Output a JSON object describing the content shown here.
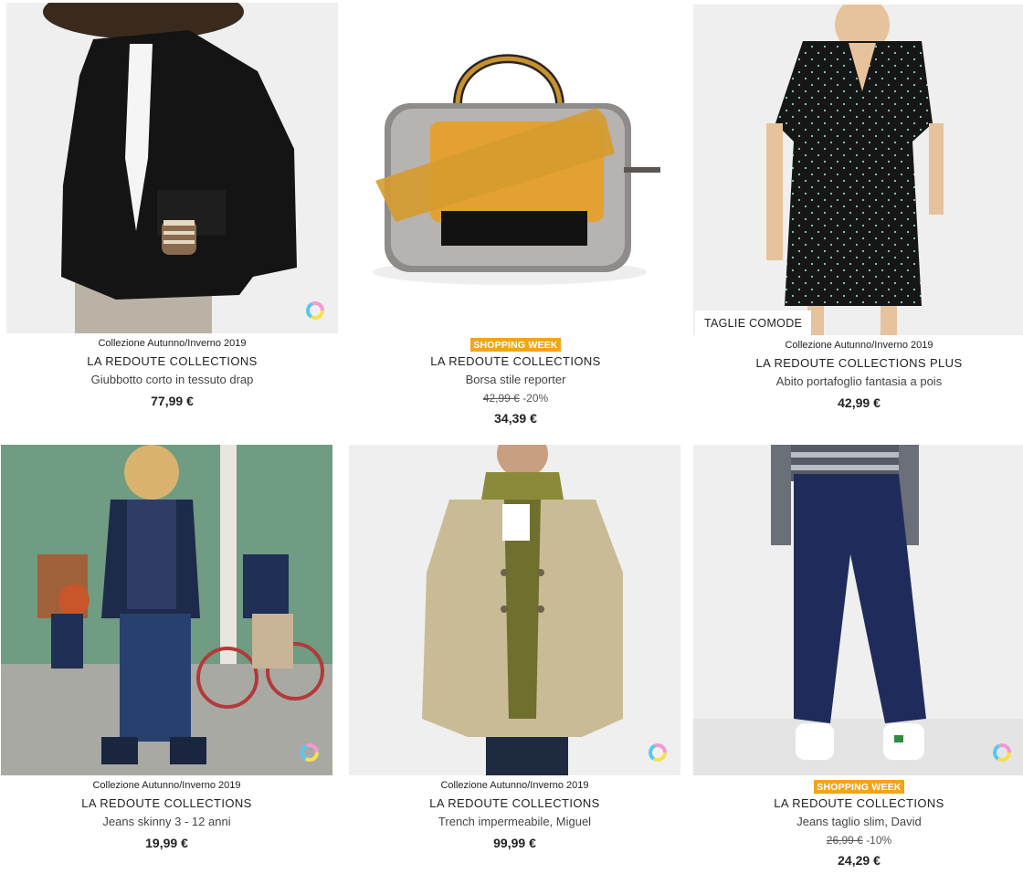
{
  "products": [
    {
      "collection": "Collezione Autunno/Inverno 2019",
      "brand": "LA REDOUTE COLLECTIONS",
      "title": "Giubbotto corto in tessuto drap",
      "price": "77,99 €",
      "image_icon": "black-jacket-photo",
      "swatch_icon": "color-swatch-icon"
    },
    {
      "badge": "SHOPPING WEEK",
      "brand": "LA REDOUTE COLLECTIONS",
      "title": "Borsa stile reporter",
      "old_price": "42,99 €",
      "discount": "-20%",
      "price": "34,39 €",
      "image_icon": "reporter-bag-photo"
    },
    {
      "collection": "Collezione Autunno/Inverno 2019",
      "brand": "LA REDOUTE COLLECTIONS PLUS",
      "title": "Abito portafoglio fantasia a pois",
      "price": "42,99 €",
      "size_tag": "TAGLIE COMODE",
      "image_icon": "polka-dot-dress-photo"
    },
    {
      "collection": "Collezione Autunno/Inverno 2019",
      "brand": "LA REDOUTE COLLECTIONS",
      "title": "Jeans skinny 3 - 12 anni",
      "price": "19,99 €",
      "image_icon": "kids-jeans-photo",
      "swatch_icon": "color-swatch-icon"
    },
    {
      "collection": "Collezione Autunno/Inverno 2019",
      "brand": "LA REDOUTE COLLECTIONS",
      "title": "Trench impermeabile, Miguel",
      "price": "99,99 €",
      "image_icon": "trench-coat-photo",
      "swatch_icon": "color-swatch-icon"
    },
    {
      "badge": "SHOPPING WEEK",
      "brand": "LA REDOUTE COLLECTIONS",
      "title": "Jeans taglio slim, David",
      "old_price": "26,99 €",
      "discount": "-10%",
      "price": "24,29 €",
      "image_icon": "slim-jeans-photo",
      "swatch_icon": "color-swatch-icon"
    }
  ],
  "colors": {
    "badge_bg": "#f2a41a",
    "text": "#222222"
  }
}
